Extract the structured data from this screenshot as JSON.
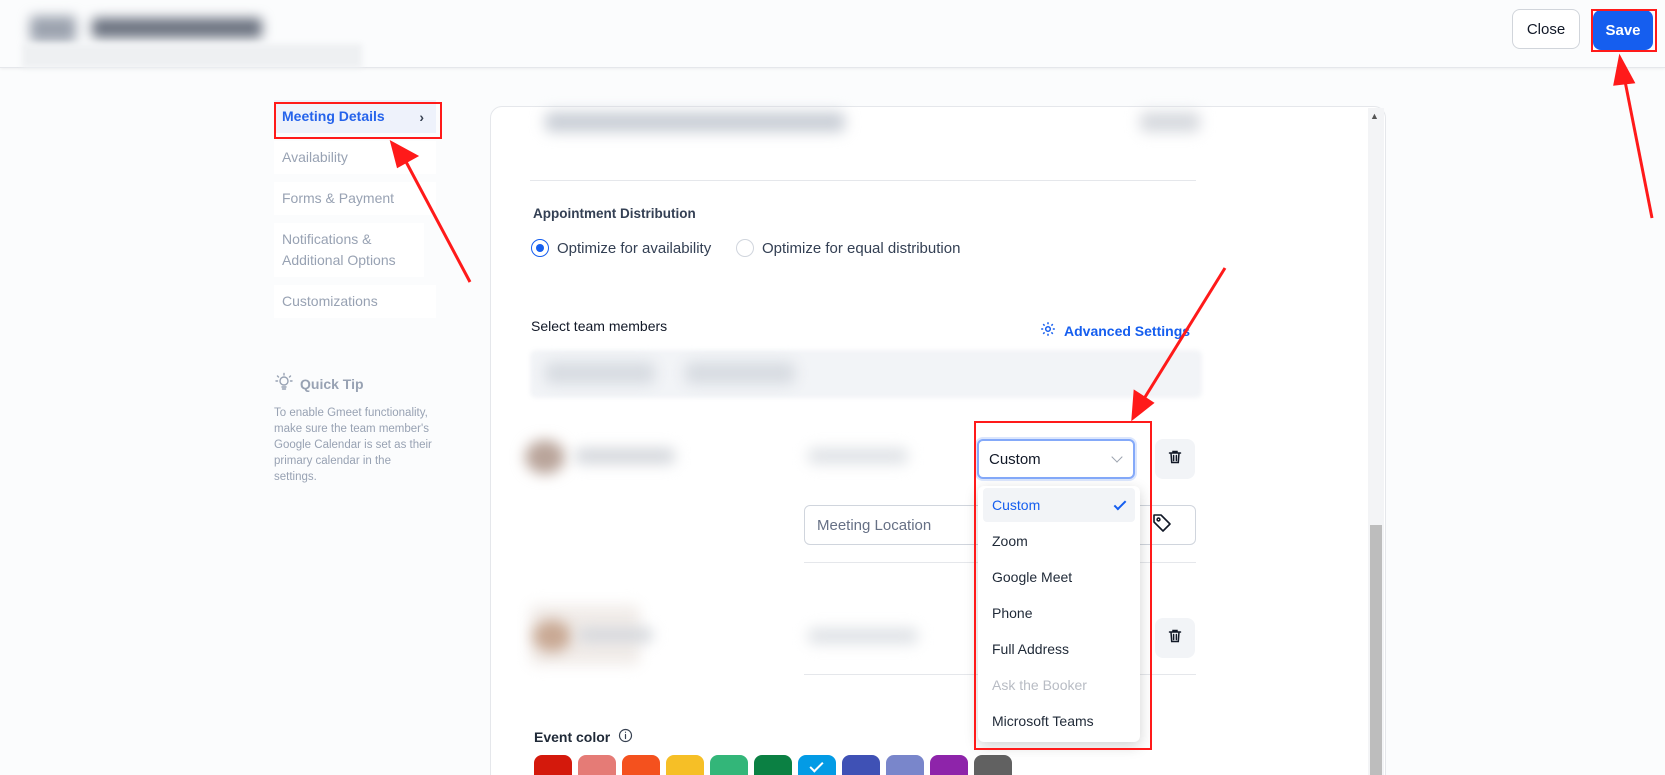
{
  "header": {
    "close_label": "Close",
    "save_label": "Save"
  },
  "sidebar": {
    "items": [
      {
        "label": "Meeting Details",
        "active": true
      },
      {
        "label": "Availability"
      },
      {
        "label": "Forms & Payment"
      },
      {
        "label": "Notifications & Additional Options"
      },
      {
        "label": "Customizations"
      }
    ],
    "quick_tip": {
      "title": "Quick Tip",
      "text": "To enable Gmeet functionality, make sure the team member's Google Calendar is set as their primary calendar in the settings."
    }
  },
  "main": {
    "appointment_distribution": {
      "title": "Appointment Distribution",
      "options": [
        {
          "label": "Optimize for availability",
          "selected": true
        },
        {
          "label": "Optimize for equal distribution",
          "selected": false
        }
      ]
    },
    "team_members": {
      "title": "Select team members",
      "advanced_settings": "Advanced Settings"
    },
    "location_select": {
      "value": "Custom",
      "options": [
        {
          "label": "Custom",
          "selected": true
        },
        {
          "label": "Zoom"
        },
        {
          "label": "Google Meet"
        },
        {
          "label": "Phone"
        },
        {
          "label": "Full Address"
        },
        {
          "label": "Ask the Booker",
          "disabled": true
        },
        {
          "label": "Microsoft Teams"
        }
      ]
    },
    "meeting_location": {
      "placeholder": "Meeting Location"
    },
    "event_color": {
      "label": "Event color",
      "swatches": [
        "#d4190c",
        "#e57b76",
        "#f4511e",
        "#f6bf26",
        "#33b679",
        "#0b8043",
        "#039be5",
        "#3f51b5",
        "#7986cb",
        "#8e24aa",
        "#616161"
      ],
      "selected_index": 6
    }
  },
  "colors": {
    "accent": "#155eef",
    "highlight": "#ff1a1a"
  }
}
